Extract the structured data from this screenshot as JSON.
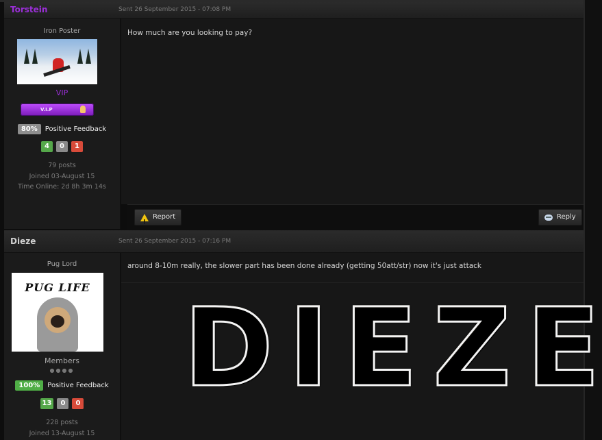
{
  "posts": [
    {
      "author": "Torstein",
      "author_color": "#9b2fd8",
      "sent": "Sent 26 September 2015 - 07:08 PM",
      "rank": "Iron Poster",
      "group": "VIP",
      "group_color": "#9b2fd8",
      "badge_text": "V.I.P",
      "feedback_percent": "80%",
      "feedback_percent_color": "#8e8e8e",
      "feedback_label": "Positive Feedback",
      "counts": [
        "4",
        "0",
        "1"
      ],
      "posts_count": "79 posts",
      "joined": "Joined 03-August 15",
      "time_online": "Time Online: 2d 8h 3m 14s",
      "message": "How much are you looking to pay?",
      "actions": {
        "report": "Report",
        "reply": "Reply"
      }
    },
    {
      "author": "Dieze",
      "author_color": "#d0d0d0",
      "sent": "Sent 26 September 2015 - 07:16 PM",
      "rank": "Pug Lord",
      "avatar_text": "PUG LIFE",
      "group": "Members",
      "group_color": "#a8a8a8",
      "feedback_percent": "100%",
      "feedback_percent_color": "#4fae46",
      "feedback_label": "Positive Feedback",
      "counts": [
        "13",
        "0",
        "0"
      ],
      "posts_count": "228 posts",
      "joined": "Joined 13-August 15",
      "message": "around 8-10m really, the slower part has been done already (getting 50att/str) now it's just attack",
      "signature_letters": [
        "D",
        "I",
        "E",
        "Z",
        "E"
      ]
    }
  ],
  "colors": {
    "positive": "#55a84a",
    "neutral": "#8a8a8a",
    "negative": "#d84b3a"
  }
}
